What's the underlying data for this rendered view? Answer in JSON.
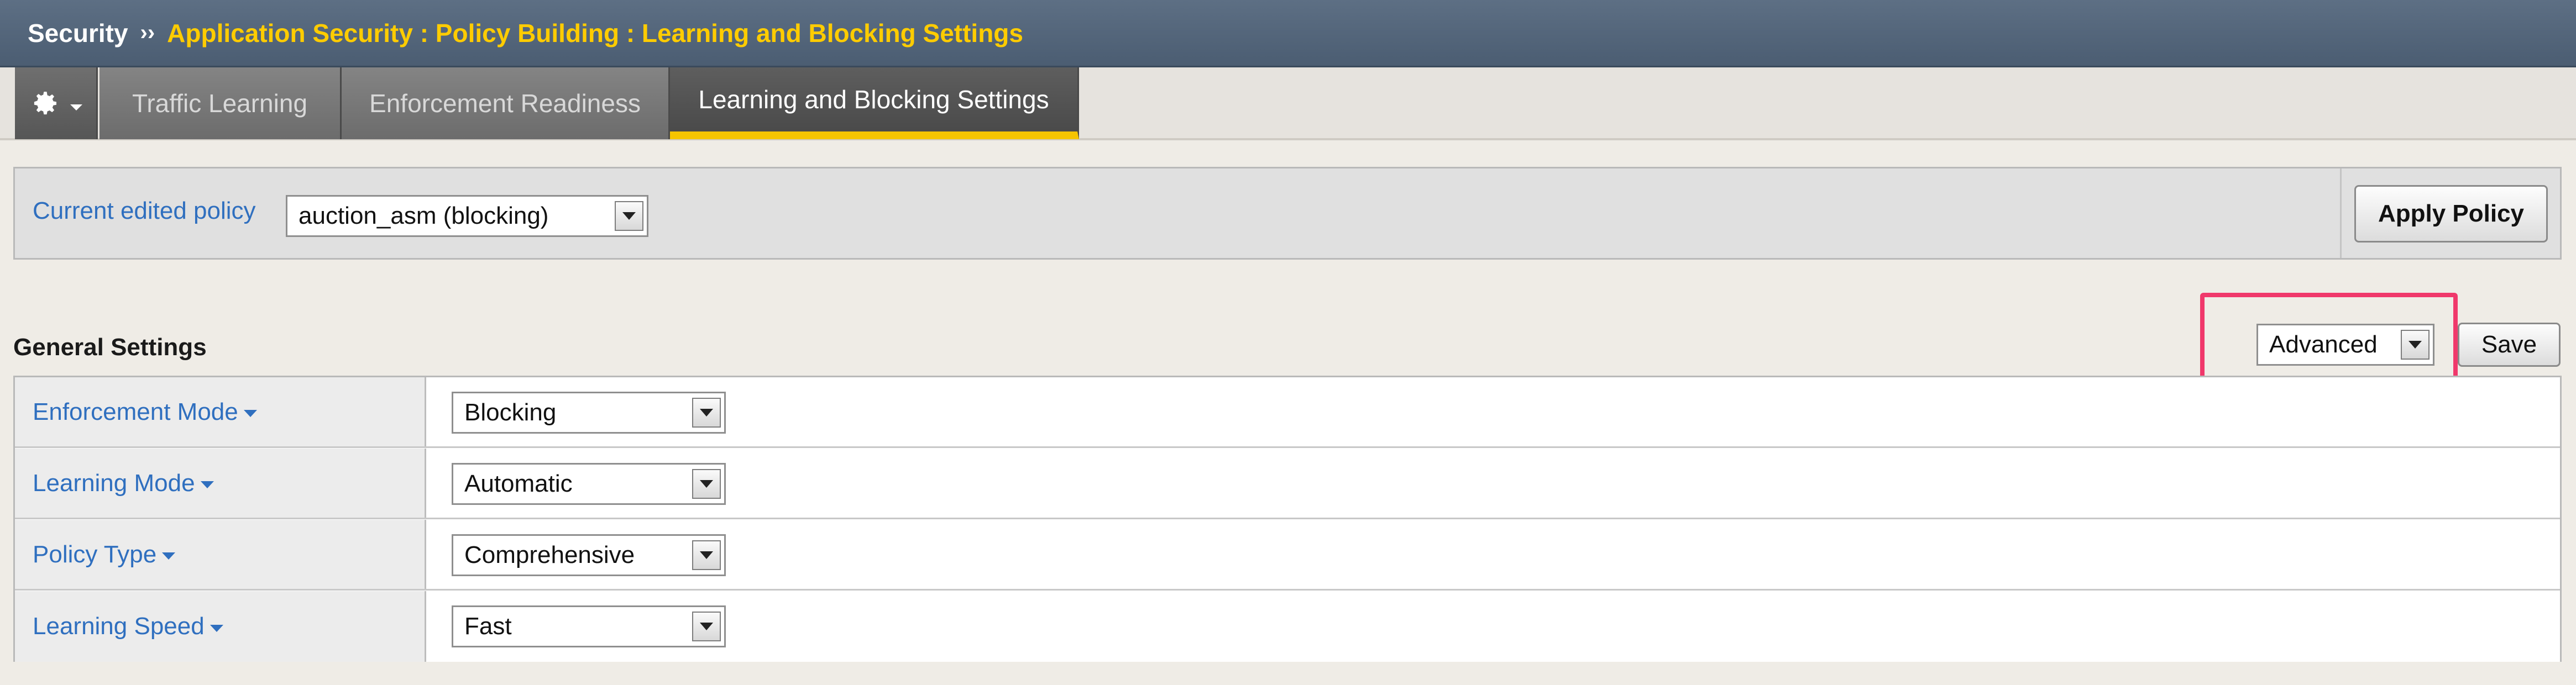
{
  "breadcrumb": {
    "section": "Security",
    "separator": "››",
    "path": "Application Security : Policy Building : Learning and Blocking Settings"
  },
  "tabs": [
    {
      "label": "Traffic Learning",
      "active": false
    },
    {
      "label": "Enforcement Readiness",
      "active": false
    },
    {
      "label": "Learning and Blocking Settings",
      "active": true
    }
  ],
  "toolbar": {
    "gear_icon": "gear-icon",
    "policy_label": "Current edited policy",
    "policy_value": "auction_asm (blocking)",
    "apply_label": "Apply Policy"
  },
  "general": {
    "title": "General Settings",
    "view_value": "Advanced",
    "save_label": "Save",
    "highlight_color": "#f0386b",
    "rows": [
      {
        "label": "Enforcement Mode",
        "value": "Blocking"
      },
      {
        "label": "Learning Mode",
        "value": "Automatic"
      },
      {
        "label": "Policy Type",
        "value": "Comprehensive"
      },
      {
        "label": "Learning Speed",
        "value": "Fast"
      }
    ]
  },
  "colors": {
    "titlebar": "#4b5d72",
    "breadcrumb_path": "#ffcc00",
    "link_blue": "#2f6fbf",
    "active_tab_underline": "#f5c400"
  }
}
